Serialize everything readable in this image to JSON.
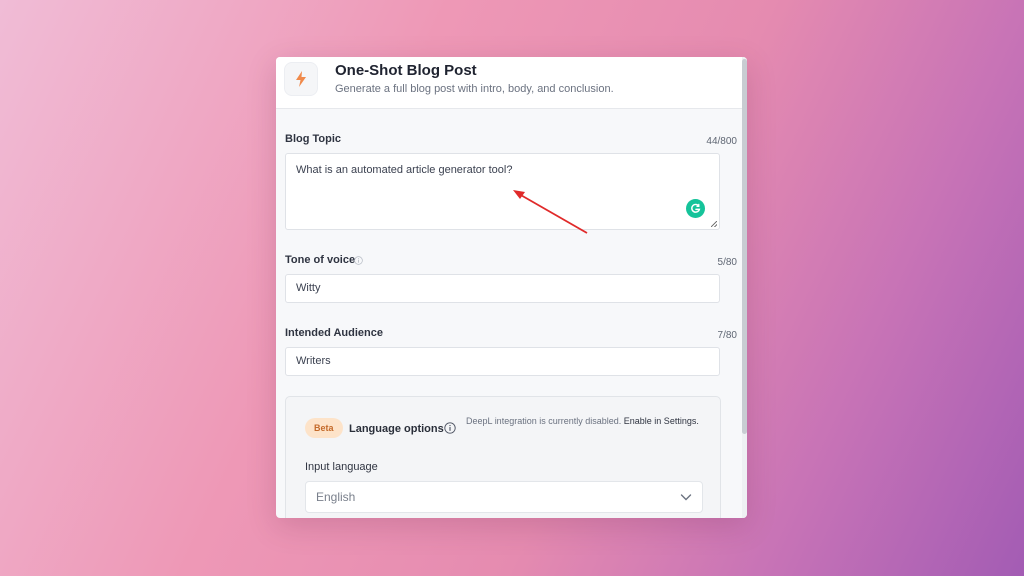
{
  "header": {
    "title": "One-Shot Blog Post",
    "subtitle": "Generate a full blog post with intro, body, and conclusion.",
    "icon": "lightning-bolt-icon",
    "icon_color": "#f08a4b"
  },
  "fields": {
    "blog_topic": {
      "label": "Blog Topic",
      "counter": "44/800",
      "value": "What is an automated article generator tool?"
    },
    "tone_of_voice": {
      "label": "Tone of voice",
      "counter": "5/80",
      "value": "Witty"
    },
    "intended_audience": {
      "label": "Intended Audience",
      "counter": "7/80",
      "value": "Writers"
    }
  },
  "language_options": {
    "badge": "Beta",
    "title": "Language options",
    "note": "DeepL integration is currently disabled.",
    "note_link": "Enable in Settings.",
    "input_language_label": "Input language",
    "input_language_value": "English"
  },
  "colors": {
    "accent_grammarly": "#15c39a",
    "beta_bg": "#fde3c9",
    "beta_text": "#c46a2a",
    "annotation_arrow": "#e02a2a"
  }
}
